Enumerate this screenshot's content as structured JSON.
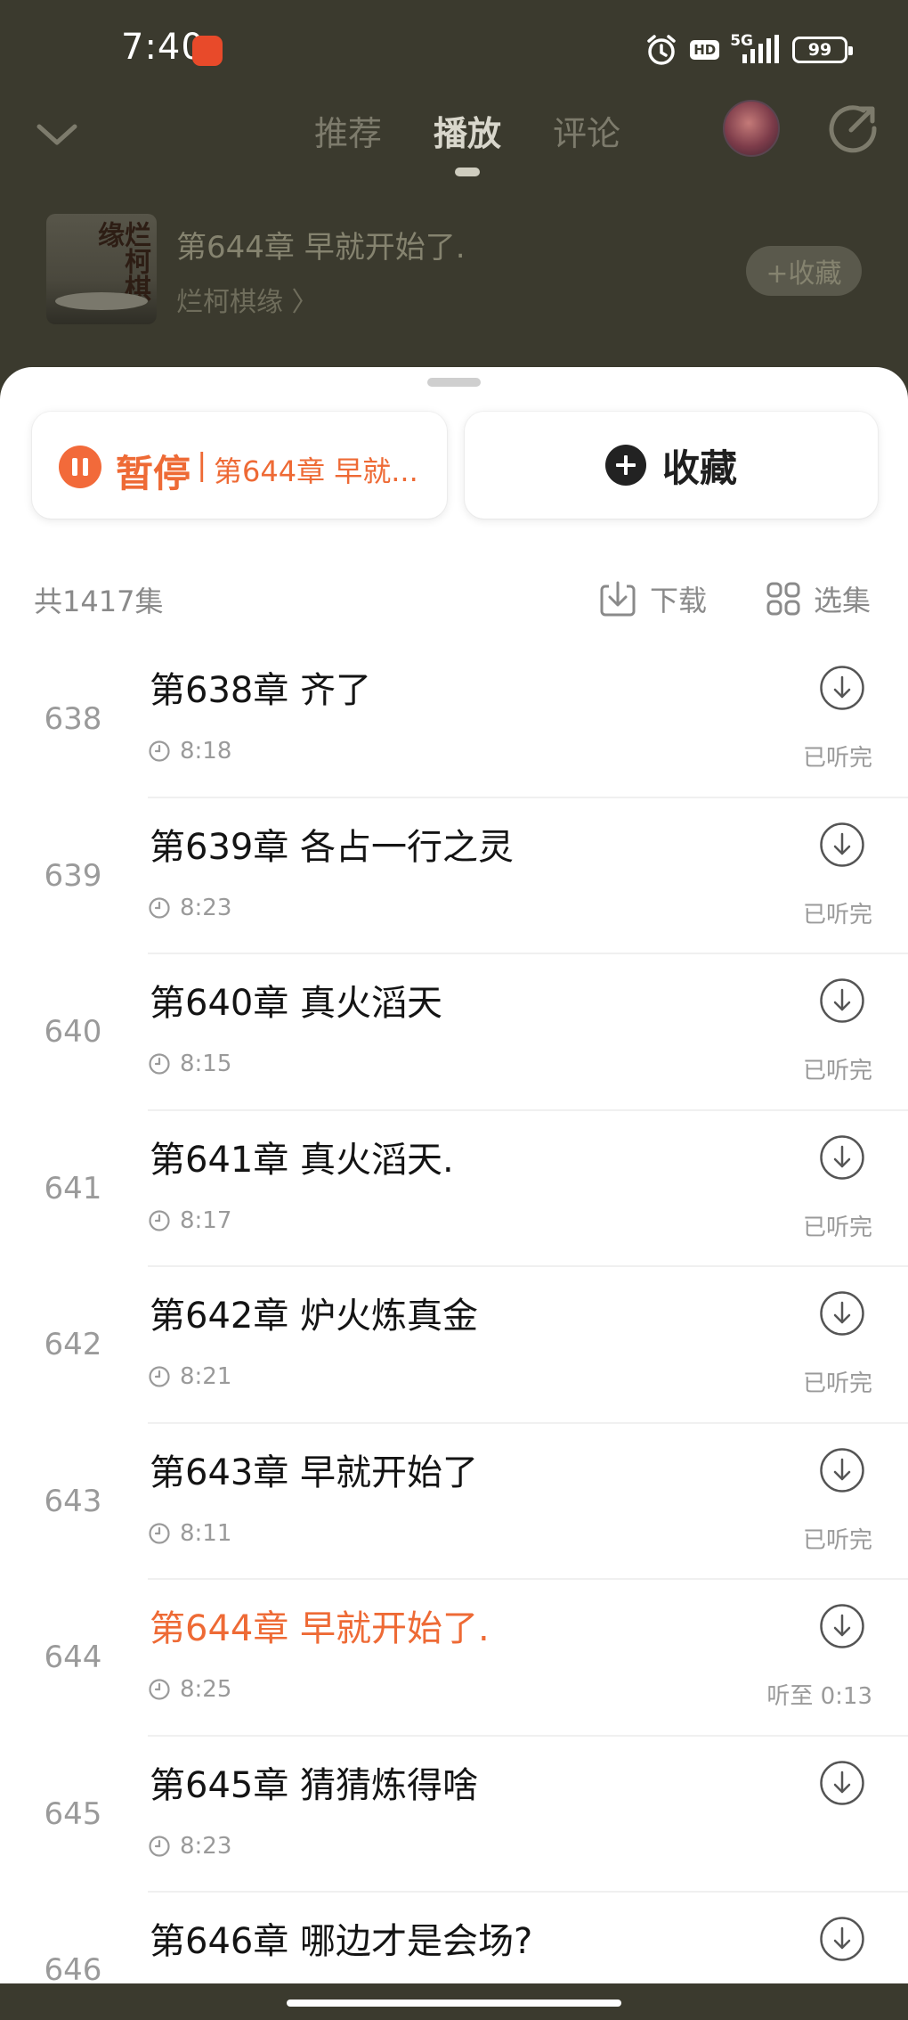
{
  "status_bar": {
    "time": "7:40",
    "hd": "HD",
    "network": "5G",
    "battery": "99"
  },
  "nav": {
    "tabs": [
      {
        "label": "推荐",
        "active": false
      },
      {
        "label": "播放",
        "active": true
      },
      {
        "label": "评论",
        "active": false
      }
    ]
  },
  "book": {
    "cover_text": "烂柯棋缘",
    "chapter_title": "第644章 早就开始了.",
    "author_link": "烂柯棋缘 〉",
    "collect_label": "+收藏"
  },
  "sheet": {
    "pause_label": "暂停",
    "pause_separator": "|",
    "current_chapter_short": "第644章 早就...",
    "collect_label": "收藏",
    "episode_count": "共1417集",
    "download_label": "下载",
    "select_label": "选集"
  },
  "episodes": [
    {
      "num": "638",
      "title": "第638章 齐了",
      "duration": "8:18",
      "status": "已听完",
      "current": false
    },
    {
      "num": "639",
      "title": "第639章 各占一行之灵",
      "duration": "8:23",
      "status": "已听完",
      "current": false
    },
    {
      "num": "640",
      "title": "第640章 真火滔天",
      "duration": "8:15",
      "status": "已听完",
      "current": false
    },
    {
      "num": "641",
      "title": "第641章 真火滔天.",
      "duration": "8:17",
      "status": "已听完",
      "current": false
    },
    {
      "num": "642",
      "title": "第642章 炉火炼真金",
      "duration": "8:21",
      "status": "已听完",
      "current": false
    },
    {
      "num": "643",
      "title": "第643章 早就开始了",
      "duration": "8:11",
      "status": "已听完",
      "current": false
    },
    {
      "num": "644",
      "title": "第644章 早就开始了.",
      "duration": "8:25",
      "status": "听至 0:13",
      "current": true
    },
    {
      "num": "645",
      "title": "第645章 猜猜炼得啥",
      "duration": "8:23",
      "status": "",
      "current": false
    },
    {
      "num": "646",
      "title": "第646章 哪边才是会场?",
      "duration": "",
      "status": "",
      "current": false
    }
  ],
  "colors": {
    "accent": "#ee6a35",
    "dim_background": "#3b3a2e"
  }
}
